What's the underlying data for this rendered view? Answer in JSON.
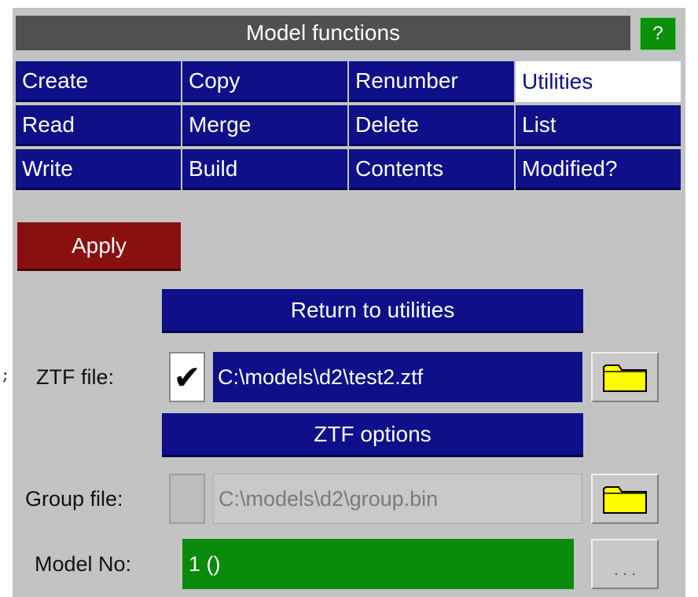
{
  "panel": {
    "title": "Model functions",
    "help_label": "?"
  },
  "tabs": [
    {
      "label": "Create",
      "active": false
    },
    {
      "label": "Copy",
      "active": false
    },
    {
      "label": "Renumber",
      "active": false
    },
    {
      "label": "Utilities",
      "active": true
    },
    {
      "label": "Read",
      "active": false
    },
    {
      "label": "Merge",
      "active": false
    },
    {
      "label": "Delete",
      "active": false
    },
    {
      "label": "List",
      "active": false
    },
    {
      "label": "Write",
      "active": false
    },
    {
      "label": "Build",
      "active": false
    },
    {
      "label": "Contents",
      "active": false
    },
    {
      "label": "Modified?",
      "active": false
    }
  ],
  "stray_mark": ";",
  "actions": {
    "apply_label": "Apply",
    "return_label": "Return to utilities",
    "ztf_options_label": "ZTF options"
  },
  "ztf": {
    "label": "ZTF file:",
    "checked": true,
    "check_glyph": "✔",
    "path": "C:\\models\\d2\\test2.ztf",
    "browse_icon": "folder-icon"
  },
  "group": {
    "label": "Group file:",
    "checked": false,
    "path": "C:\\models\\d2\\group.bin",
    "browse_icon": "folder-icon"
  },
  "model": {
    "label": "Model No:",
    "value": "1 ()",
    "more_label": ". . ."
  },
  "colors": {
    "tab_blue": "#0f0f8a",
    "apply_red": "#8a0f0f",
    "model_green": "#0a8a0a",
    "panel_grey": "#c3c3c3",
    "folder_yellow": "#ffff00"
  }
}
